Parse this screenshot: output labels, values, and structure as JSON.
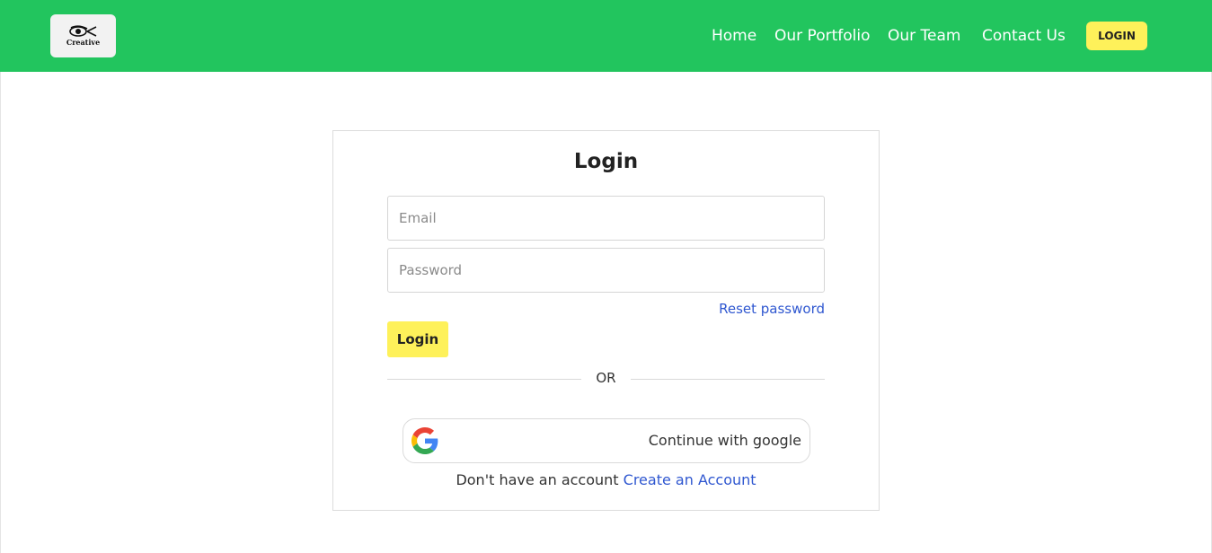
{
  "header": {
    "logo_text": "Creative",
    "nav": [
      {
        "label": "Home"
      },
      {
        "label": "Our Portfolio"
      },
      {
        "label": "Our Team"
      },
      {
        "label": "Contact Us"
      }
    ],
    "login_label": "LOGIN"
  },
  "login_card": {
    "title": "Login",
    "email": {
      "placeholder": "Email",
      "value": ""
    },
    "password": {
      "placeholder": "Password",
      "value": ""
    },
    "reset_label": "Reset password",
    "submit_label": "Login",
    "divider_label": "OR",
    "google_label": "Continue with google",
    "signup_prompt": "Don't have an account",
    "signup_link": "Create an Account"
  },
  "colors": {
    "brand_green": "#22c55e",
    "accent_yellow": "#fef15a",
    "link_blue": "#2f57d0"
  },
  "icons": [
    "eye-logo-icon",
    "google-icon"
  ]
}
